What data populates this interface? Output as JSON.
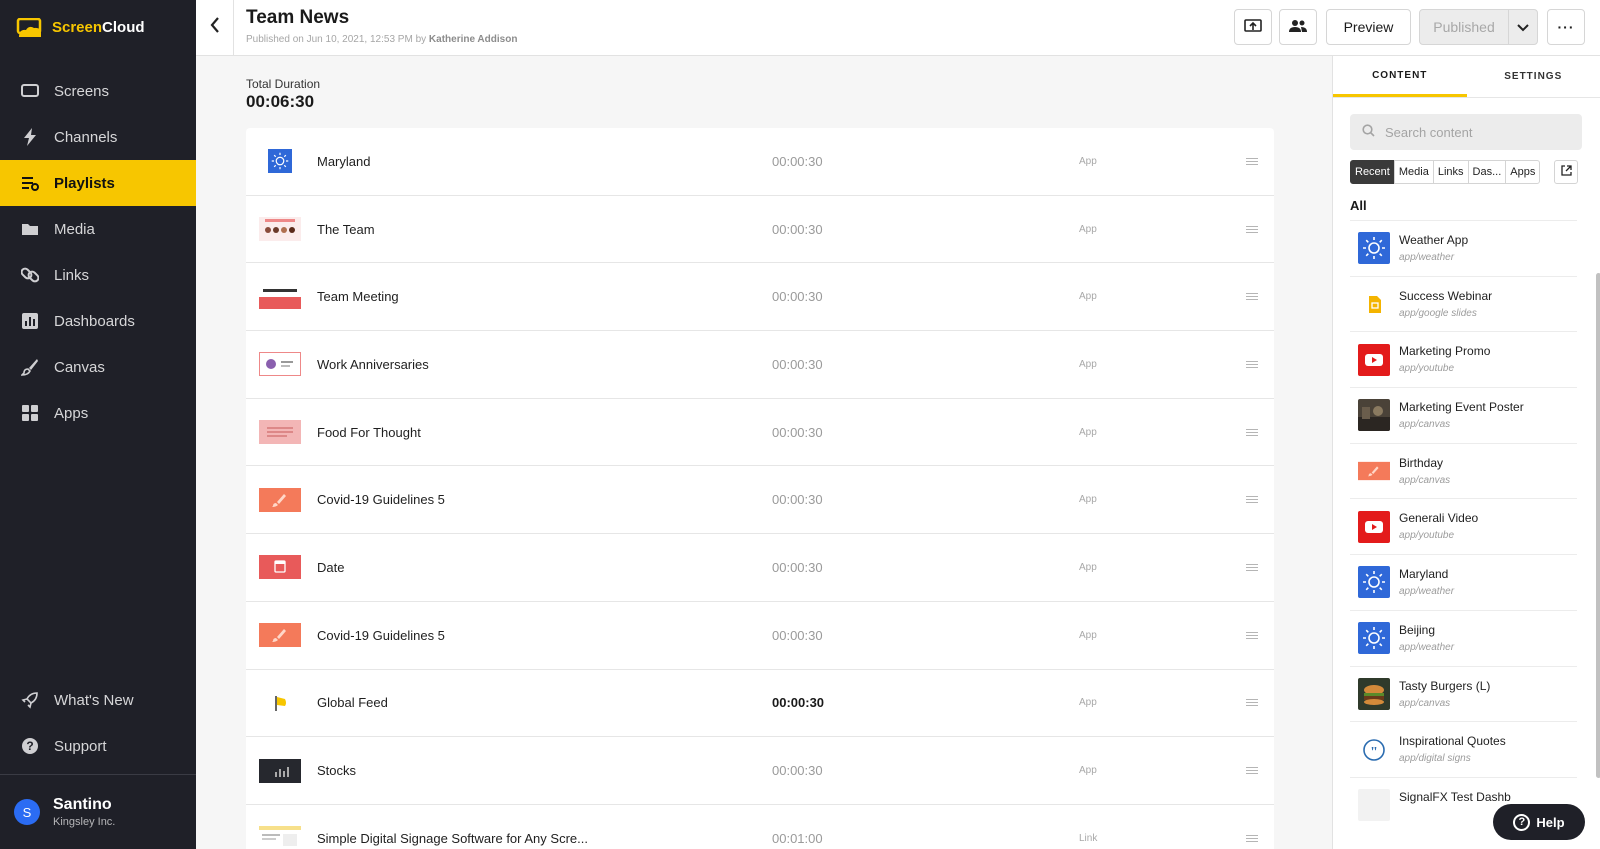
{
  "app": {
    "brand_part1": "Screen",
    "brand_part2": "Cloud",
    "accent_color": "#f7c600"
  },
  "sidebar": {
    "items": [
      {
        "label": "Screens",
        "icon": "screen-icon"
      },
      {
        "label": "Channels",
        "icon": "lightning-icon"
      },
      {
        "label": "Playlists",
        "icon": "playlist-icon",
        "active": true
      },
      {
        "label": "Media",
        "icon": "folder-icon"
      },
      {
        "label": "Links",
        "icon": "link-icon"
      },
      {
        "label": "Dashboards",
        "icon": "dashboard-icon"
      },
      {
        "label": "Canvas",
        "icon": "brush-icon"
      },
      {
        "label": "Apps",
        "icon": "apps-grid-icon"
      }
    ],
    "bottom_items": [
      {
        "label": "What's New",
        "icon": "rocket-icon"
      },
      {
        "label": "Support",
        "icon": "question-icon"
      }
    ],
    "user": {
      "initial": "S",
      "name": "Santino",
      "org": "Kingsley Inc."
    }
  },
  "header": {
    "title": "Team News",
    "subtitle_prefix": "Published on Jun 10, 2021, 12:53 PM by ",
    "subtitle_author": "Katherine Addison",
    "preview_label": "Preview",
    "published_label": "Published",
    "more_label": "···"
  },
  "main": {
    "duration_label": "Total Duration",
    "duration_value": "00:06:30",
    "rows": [
      {
        "name": "Maryland",
        "duration": "00:00:30",
        "type": "App",
        "thumb": "weather"
      },
      {
        "name": "The Team",
        "duration": "00:00:30",
        "type": "App",
        "thumb": "team"
      },
      {
        "name": "Team Meeting",
        "duration": "00:00:30",
        "type": "App",
        "thumb": "meeting"
      },
      {
        "name": "Work Anniversaries",
        "duration": "00:00:30",
        "type": "App",
        "thumb": "anniv"
      },
      {
        "name": "Food For Thought",
        "duration": "00:00:30",
        "type": "App",
        "thumb": "food"
      },
      {
        "name": "Covid-19 Guidelines 5",
        "duration": "00:00:30",
        "type": "App",
        "thumb": "canvas"
      },
      {
        "name": "Date",
        "duration": "00:00:30",
        "type": "App",
        "thumb": "date"
      },
      {
        "name": "Covid-19 Guidelines 5",
        "duration": "00:00:30",
        "type": "App",
        "thumb": "canvas"
      },
      {
        "name": "Global Feed",
        "duration": "00:00:30",
        "type": "App",
        "thumb": "feed",
        "bold": true
      },
      {
        "name": "Stocks",
        "duration": "00:00:30",
        "type": "App",
        "thumb": "stocks"
      },
      {
        "name": "Simple Digital Signage Software for Any Scre...",
        "duration": "00:01:00",
        "type": "Link",
        "thumb": "link"
      }
    ]
  },
  "panel": {
    "tabs": [
      "CONTENT",
      "SETTINGS"
    ],
    "search_placeholder": "Search content",
    "filters": [
      "Recent",
      "Media",
      "Links",
      "Das...",
      "Apps"
    ],
    "all_label": "All",
    "items": [
      {
        "name": "Weather App",
        "path": "app/weather",
        "thumb": "weather"
      },
      {
        "name": "Success Webinar",
        "path": "app/google slides",
        "thumb": "slides"
      },
      {
        "name": "Marketing Promo",
        "path": "app/youtube",
        "thumb": "youtube"
      },
      {
        "name": "Marketing Event Poster",
        "path": "app/canvas",
        "thumb": "photo"
      },
      {
        "name": "Birthday",
        "path": "app/canvas",
        "thumb": "canvas"
      },
      {
        "name": "Generali Video",
        "path": "app/youtube",
        "thumb": "youtube"
      },
      {
        "name": "Maryland",
        "path": "app/weather",
        "thumb": "weather"
      },
      {
        "name": "Beijing",
        "path": "app/weather",
        "thumb": "weather"
      },
      {
        "name": "Tasty Burgers (L)",
        "path": "app/canvas",
        "thumb": "burger"
      },
      {
        "name": "Inspirational Quotes",
        "path": "app/digital signs",
        "thumb": "quote"
      },
      {
        "name": "SignalFX Test Dashb",
        "path": "",
        "thumb": "blank"
      }
    ],
    "help_label": "Help"
  }
}
